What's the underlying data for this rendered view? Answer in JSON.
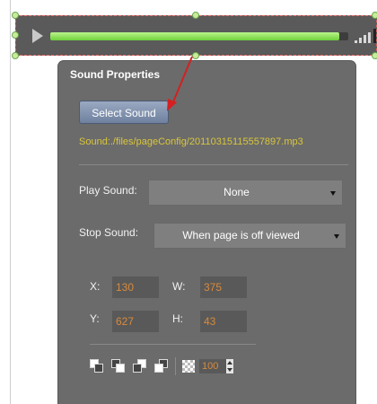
{
  "sound_bar": {
    "progress": 0.97,
    "colors": {
      "fill": "#7ee048",
      "selection": "#e06060"
    }
  },
  "panel": {
    "title": "Sound Properties",
    "select_sound_label": "Select Sound",
    "sound_path": "Sound:./files/pageConfig/20110315115557897.mp3",
    "play_sound": {
      "label": "Play Sound:",
      "value": "None"
    },
    "stop_sound": {
      "label": "Stop Sound:",
      "value": "When page is off viewed"
    },
    "position": {
      "x_label": "X:",
      "x_value": "130",
      "w_label": "W:",
      "w_value": "375",
      "y_label": "Y:",
      "y_value": "627",
      "h_label": "H:",
      "h_value": "43"
    },
    "opacity_value": "100"
  },
  "icons": {
    "play": "play-icon",
    "volume": "volume-icon",
    "tools": [
      "bring-to-front-icon",
      "send-to-back-icon",
      "bring-forward-icon",
      "send-backward-icon",
      "transparency-icon"
    ]
  }
}
